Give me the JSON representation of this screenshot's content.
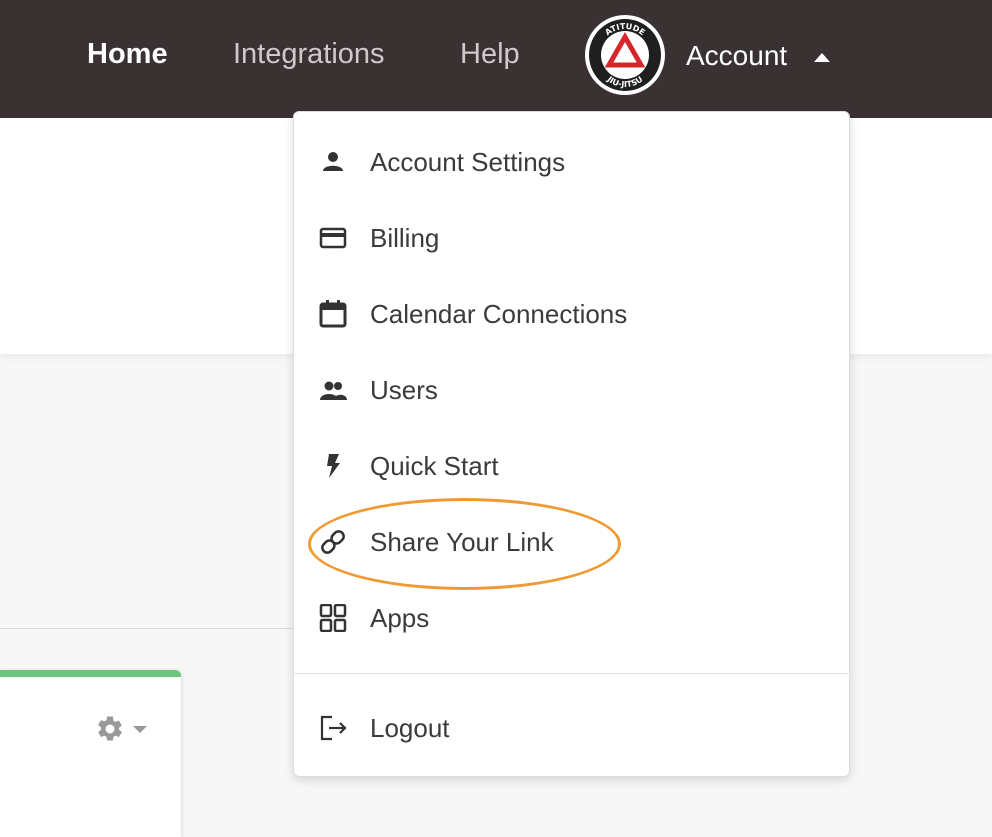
{
  "nav": {
    "home": "Home",
    "integrations": "Integrations",
    "help": "Help",
    "account": "Account"
  },
  "avatar": {
    "logo_text_top": "ATITUDE",
    "logo_text_bottom": "JIU-JITSU",
    "logo_colors": {
      "ring": "#1f1f1f",
      "accent": "#d7262b"
    }
  },
  "account_menu": {
    "items": [
      {
        "label": "Account Settings",
        "icon": "person-icon"
      },
      {
        "label": "Billing",
        "icon": "credit-card-icon"
      },
      {
        "label": "Calendar Connections",
        "icon": "calendar-icon"
      },
      {
        "label": "Users",
        "icon": "users-icon"
      },
      {
        "label": "Quick Start",
        "icon": "lightning-icon"
      },
      {
        "label": "Share Your Link",
        "icon": "link-icon"
      },
      {
        "label": "Apps",
        "icon": "apps-grid-icon"
      }
    ],
    "logout": {
      "label": "Logout",
      "icon": "logout-icon"
    }
  },
  "card": {
    "icon": "gear-icon",
    "accent": "#6cc57c"
  },
  "annotation": {
    "color": "#f09a34",
    "target": "Share Your Link"
  }
}
